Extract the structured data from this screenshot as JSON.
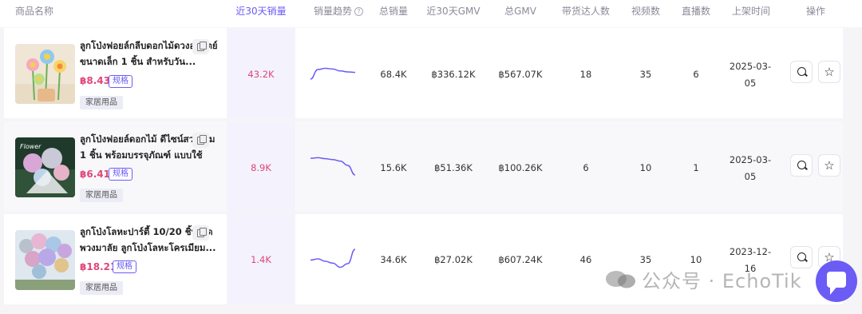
{
  "header": {
    "product_name": "商品名称",
    "sales_30d": "近30天销量",
    "sales_trend": "销量趋势",
    "help_glyph": "?",
    "total_sales": "总销量",
    "gmv_30d": "近30天GMV",
    "total_gmv": "总GMV",
    "influencers": "带货达人数",
    "videos": "视频数",
    "livestreams": "直播数",
    "listed_time": "上架时间",
    "actions": "操作"
  },
  "rows": [
    {
      "name": "ลูกโป่งฟอยล์กลีบดอกไม้ดวงอาทิตย์ขนาดเล็ก 1 ชิ้น สำหรับวัน...",
      "price": "฿8.43",
      "spec": "规格",
      "category": "家居用品",
      "sales_30d": "43.2K",
      "total_sales": "68.4K",
      "gmv_30d": "฿336.12K",
      "total_gmv": "฿567.07K",
      "influencers": "18",
      "videos": "35",
      "livestreams": "6",
      "listed_date": "2025-03-05",
      "trend": [
        0.3,
        0.7,
        0.75,
        0.72,
        0.64,
        0.6,
        0.58
      ]
    },
    {
      "name": "ลูกโป่งฟอยล์ดอกไม้ ดีไซน์สวยงาม 1 ชิ้น พร้อมบรรจุภัณฑ์ แบบใช้มือ...",
      "price": "฿6.41",
      "spec": "规格",
      "category": "家居用品",
      "sales_30d": "8.9K",
      "total_sales": "15.6K",
      "gmv_30d": "฿51.36K",
      "total_gmv": "฿100.26K",
      "influencers": "6",
      "videos": "10",
      "livestreams": "1",
      "listed_date": "2025-03-05",
      "trend": [
        0.8,
        0.82,
        0.78,
        0.74,
        0.68,
        0.5,
        0.1
      ]
    },
    {
      "name": "ลูกโป่งโลหะปาร์ตี้ 10/20 ชิ้น ชุดพวงมาลัย ลูกโป่งโลหะโครเมียม...",
      "price": "฿18.21",
      "spec": "规格",
      "category": "家居用品",
      "sales_30d": "1.4K",
      "total_sales": "34.6K",
      "gmv_30d": "฿27.02K",
      "total_gmv": "฿607.24K",
      "influencers": "46",
      "videos": "35",
      "livestreams": "10",
      "listed_date": "2023-12-16",
      "trend": [
        0.45,
        0.5,
        0.4,
        0.32,
        0.15,
        0.3,
        0.9
      ]
    }
  ],
  "watermark": "公众号 · EchoTik",
  "colors": {
    "accent": "#6b5cf6",
    "price": "#e0457b",
    "band": "#f3f2fd"
  }
}
